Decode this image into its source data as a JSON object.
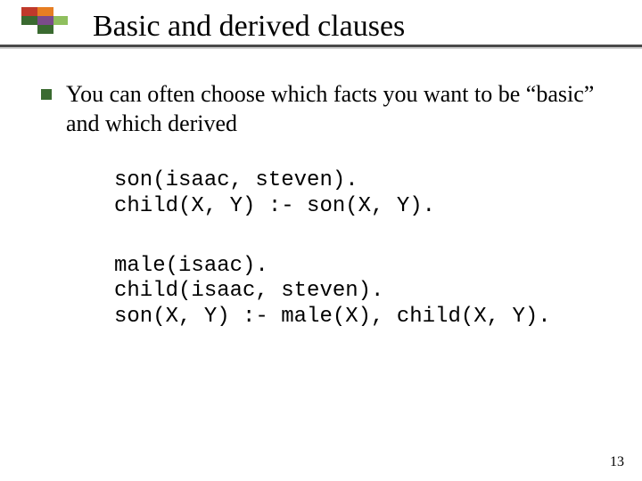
{
  "title": "Basic and derived clauses",
  "bullet": {
    "text": "You can often choose which facts you want to be “basic” and which derived"
  },
  "code1": "son(isaac, steven).\nchild(X, Y) :- son(X, Y).",
  "code2": "male(isaac).\nchild(isaac, steven).\nson(X, Y) :- male(X), child(X, Y).",
  "page_number": "13",
  "logo_colors": {
    "red": "#c0392b",
    "orange": "#e67e22",
    "green_dark": "#3a6a30",
    "purple": "#7b4b8a",
    "green_light": "#8fbf5e"
  }
}
